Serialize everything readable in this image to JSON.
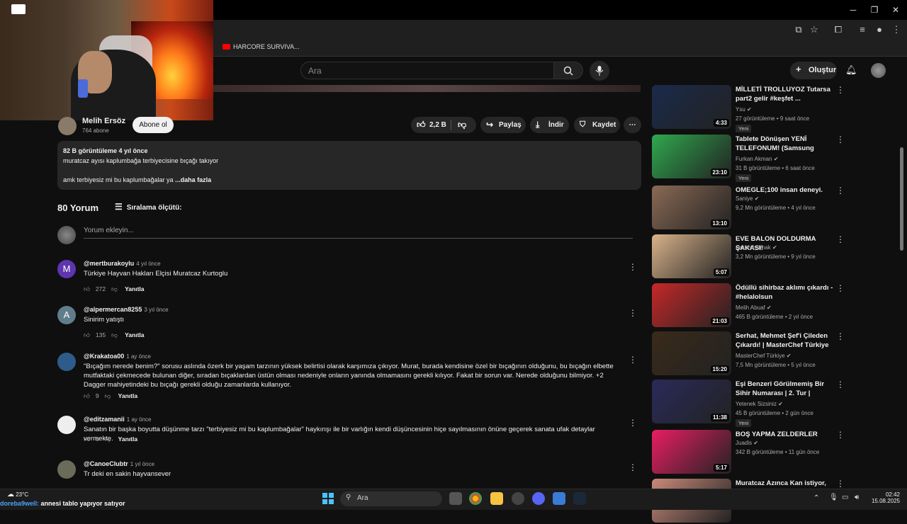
{
  "browser": {
    "bookmark": "HARCORE SURVIVA...",
    "bookmark_color": "#ff0000"
  },
  "header": {
    "search_placeholder": "Ara",
    "create_label": "Oluştur"
  },
  "channel": {
    "name": "Melih Ersöz",
    "subs": "764 abone",
    "subscribe_label": "Abone ol"
  },
  "actions": {
    "likes": "2,2 B",
    "share": "Paylaş",
    "download": "İndir",
    "save": "Kaydet"
  },
  "description": {
    "meta": "82 B görüntüleme  4 yıl önce",
    "line1": "muratcaz ayısı kaplumbağa terbiyecisine bıçağı takıyor",
    "line2": "amk terbiyesiz mi bu kaplumbağalar ya",
    "more": "...daha fazla"
  },
  "comments_section": {
    "count": "80 Yorum",
    "sort": "Sıralama ölçütü:",
    "add_placeholder": "Yorum ekleyin...",
    "reply_label": "Yanıtla"
  },
  "comments": [
    {
      "user": "@mertburakoylu",
      "ago": "4 yıl önce",
      "text": "Türkiye Hayvan Hakları Elçisi Muratcaz Kurtoglu",
      "likes": "272",
      "avatar_letter": "M",
      "avatar_color": "#5e35b1"
    },
    {
      "user": "@alpermercan8255",
      "ago": "3 yıl önce",
      "text": "Sinirim yatıştı",
      "likes": "135",
      "avatar_letter": "A",
      "avatar_color": "#607d8b"
    },
    {
      "user": "@Krakatoa00",
      "ago": "1 ay önce",
      "text": "\"Bıçağım nerede benim?\" sorusu aslında özerk bir yaşam tarzının yüksek belirtisi olarak karşımıza çıkıyor. Murat, burada kendisine özel bir bıçağının olduğunu, bu bıçağın elbette mutfaktaki çekmecede bulunan diğer, sıradan bıçaklardan üstün olması nedeniyle onların yanında olmamasını gerekli kılıyor. Fakat bir sorun var. Nerede olduğunu bilmiyor. +2 Dagger mahiyetindeki bu bıçağı gerekli olduğu zamanlarda kullanıyor.",
      "likes": "9",
      "avatar_letter": "",
      "avatar_color": "#2e5c8a"
    },
    {
      "user": "@editzamanii",
      "ago": "1 ay önce",
      "text": "Sanatın bir başka boyutta düşünme tarzı \"terbiyesiz mi bu kaplumbağalar\" haykırışı ile bir varlığın kendi düşüncesinin hiçe sayılmasının önüne geçerek sanata ufak detaylar vermekte.",
      "likes": "6",
      "avatar_letter": "",
      "avatar_color": "#eeeeee"
    },
    {
      "user": "@CanoeClubtr",
      "ago": "1 yıl önce",
      "text": "Tr deki en sakin hayvansever",
      "likes": "",
      "avatar_letter": "",
      "avatar_color": "#6b6b5a"
    }
  ],
  "sidebar": [
    {
      "title": "MİLLETİ TROLLUYOZ Tutarsa part2 gelir #keşfet ...",
      "channel": "Ysu",
      "meta": "27 görüntüleme • 9 saat önce",
      "badge": "Yeni",
      "duration": "4:33",
      "color": "#1a2a4a"
    },
    {
      "title": "Tablete Dönüşen YENİ TELEFONUM! (Samsung Galax...",
      "channel": "Furkan Akman",
      "meta": "31 B görüntüleme • 6 saat önce",
      "badge": "Yeni",
      "duration": "23:10",
      "color": "#2fa84f"
    },
    {
      "title": "OMEGLE;100 insan deneyi.",
      "channel": "Saniye",
      "meta": "9,2 Mn görüntüleme • 4 yıl önce",
      "badge": "",
      "duration": "13:10",
      "color": "#8a6a55"
    },
    {
      "title": "EVE BALON DOLDURMA ŞAKASI!",
      "channel": "Orkun Işıtmak",
      "meta": "3,2 Mn görüntüleme • 9 yıl önce",
      "badge": "",
      "duration": "5:07",
      "color": "#d9b38a"
    },
    {
      "title": "Ödüllü sihirbaz aklımı çıkardı - #helalolsun",
      "channel": "Melih Abuaf",
      "meta": "465 B görüntüleme • 2 yıl önce",
      "badge": "",
      "duration": "21:03",
      "color": "#c62828"
    },
    {
      "title": "Serhat, Mehmet Şef'i Çileden Çıkardı! | MasterChef Türkiye 5...",
      "channel": "MasterChef Türkiye",
      "meta": "7,5 Mn görüntüleme • 5 yıl önce",
      "badge": "",
      "duration": "15:20",
      "color": "#3a2a1a"
    },
    {
      "title": "Eşi Benzeri Görülmemiş Bir Sihir Numarası | 2. Tur | Yetenek ...",
      "channel": "Yetenek Sizsiniz",
      "meta": "45 B görüntüleme • 2 gün önce",
      "badge": "Yeni",
      "duration": "11:38",
      "color": "#2a2a5a"
    },
    {
      "title": "BOŞ YAPMA ZELDERLER",
      "channel": "Juadis",
      "meta": "342 B görüntüleme • 11 gün önce",
      "badge": "",
      "duration": "5:17",
      "color": "#e91e63"
    },
    {
      "title": "Muratcaz Azınca Kan istiyor,",
      "channel": "",
      "meta": "",
      "badge": "",
      "duration": "",
      "color": "#c98a7a"
    }
  ],
  "taskbar": {
    "search": "Ara",
    "temp": "23°C",
    "time": "02:42",
    "date": "15.08.2025"
  },
  "overlay_chat": {
    "user": "doreba9well:",
    "message": "annesi tablo yapıyor satıyor"
  }
}
